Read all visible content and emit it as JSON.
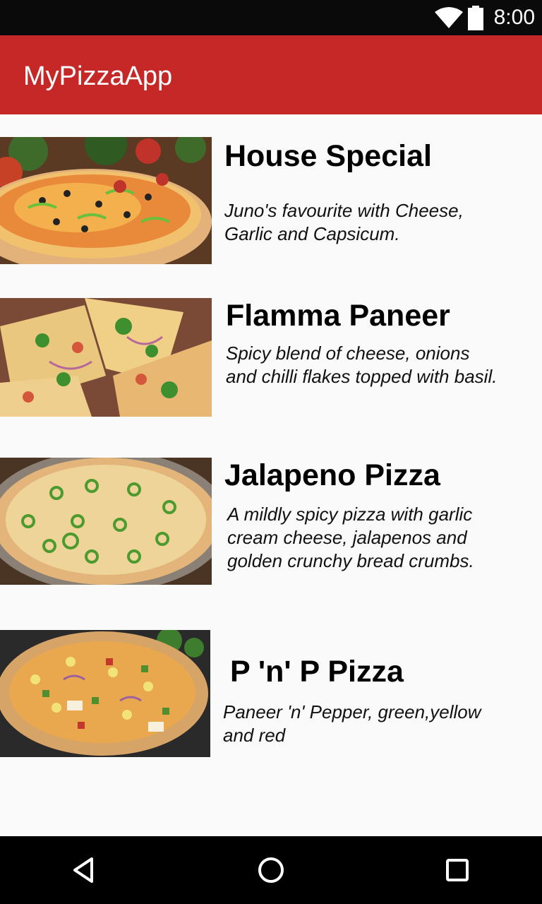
{
  "status_bar": {
    "time": "8:00",
    "wifi_icon": "wifi-icon",
    "battery_icon": "battery-icon"
  },
  "app_bar": {
    "title": "MyPizzaApp",
    "color": "#c62828"
  },
  "pizzas": [
    {
      "name": "House Special",
      "description": "Juno's favourite with Cheese, Garlic and Capsicum."
    },
    {
      "name": "Flamma Paneer",
      "description": "Spicy blend of cheese, onions and chilli flakes topped with basil."
    },
    {
      "name": "Jalapeno Pizza",
      "description": "A mildly spicy pizza with garlic cream cheese, jalapenos and golden crunchy bread crumbs."
    },
    {
      "name": "P 'n' P Pizza",
      "description": "Paneer 'n' Pepper, green,yellow and red"
    }
  ],
  "nav_bar": {
    "back_icon": "back-icon",
    "home_icon": "home-icon",
    "recents_icon": "recents-icon"
  }
}
